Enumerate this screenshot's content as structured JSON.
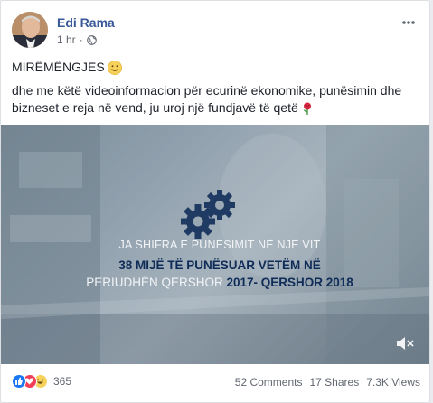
{
  "post": {
    "author": "Edi Rama",
    "time": "1 hr",
    "time_separator": "·",
    "greeting": "MIRËMËNGJES",
    "body": "dhe me këtë videoinformacion për ecurinë ekonomike, punësimin dhe bizneset e reja në vend, ju uroj një fundjavë të qetë"
  },
  "video": {
    "line1": "JA SHIFRA E PUNËSIMIT NË NJË VIT",
    "line2": "38 MIJË TË PUNËSUAR VETËM NË",
    "line3_prefix": "PERIUDHËN QERSHOR",
    "line3_bold": "2017- QERSHOR 2018"
  },
  "footer": {
    "reaction_count": "365",
    "comments": "52 Comments",
    "shares": "17 Shares",
    "views": "7.3K Views"
  },
  "icons": {
    "globe": "globe-icon",
    "more": "more-options-icon",
    "mute": "speaker-muted-icon",
    "smile": "smile-emoji-icon",
    "rose": "rose-emoji-icon"
  },
  "colors": {
    "author_link": "#385898",
    "like": "#1877f2",
    "love": "#f33e58",
    "haha": "#f7d25b",
    "video_headline": "#0f2b57"
  }
}
